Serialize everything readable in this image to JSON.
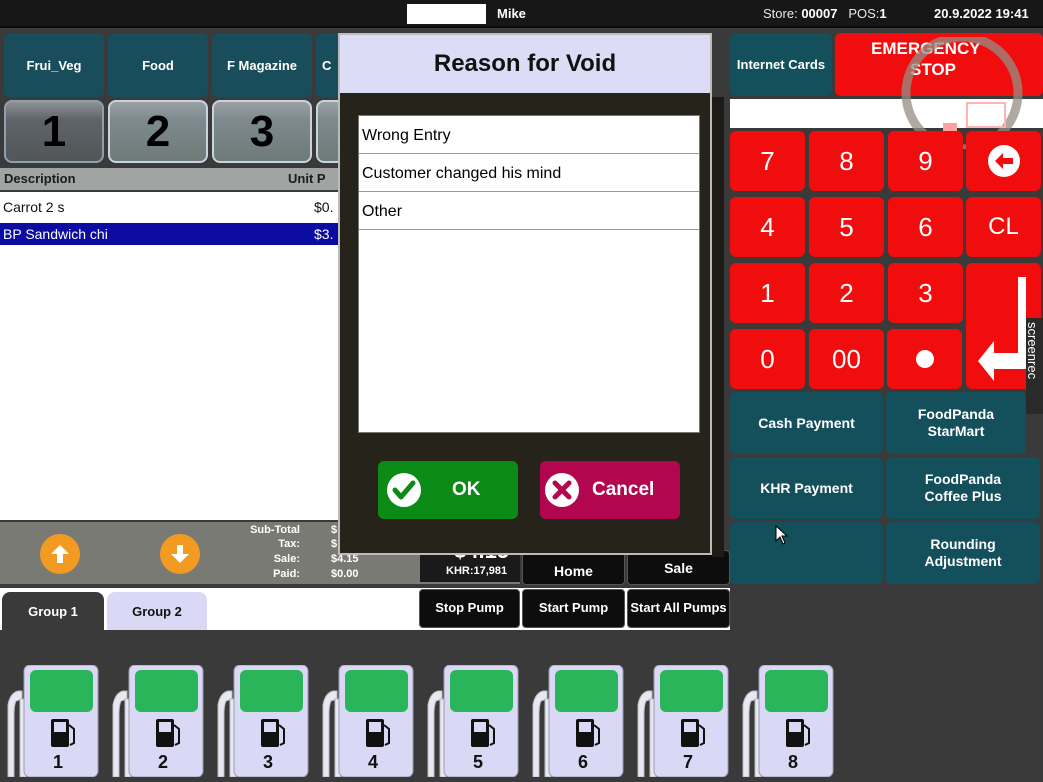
{
  "topbar": {
    "user": "Mike",
    "store_label": "Store:",
    "store": "00007",
    "pos_label": "POS:",
    "pos": "1",
    "datetime": "20.9.2022 19:41"
  },
  "categories": [
    "Frui_Veg",
    "Food",
    "F Magazine",
    "C"
  ],
  "tabs": [
    "1",
    "2",
    "3"
  ],
  "list": {
    "headers": {
      "description": "Description",
      "unit_price": "Unit P"
    },
    "rows": [
      {
        "description": "Carrot 2 s",
        "price": "$0."
      },
      {
        "description": "BP Sandwich chi",
        "price": "$3."
      }
    ]
  },
  "totals": {
    "subtotal_label": "Sub-Total",
    "tax_label": "Tax:",
    "sale_label": "Sale:",
    "paid_label": "Paid:",
    "subtotal_value": "$",
    "tax_value": "$",
    "sale_value": "$4.15",
    "paid_value": "$0.00",
    "big_total": "$4.15",
    "khr": "KHR:17,981"
  },
  "bottom_buttons": {
    "home": "Home",
    "sale": "Sale",
    "stop_pump": "Stop Pump",
    "start_pump": "Start Pump",
    "start_all": "Start All Pumps"
  },
  "pump_tabs": [
    "Group 1",
    "Group 2"
  ],
  "pumps": [
    "1",
    "2",
    "3",
    "4",
    "5",
    "6",
    "7",
    "8"
  ],
  "right": {
    "internet_cards": "Internet Cards",
    "emergency_line1": "EMERGENCY",
    "emergency_line2": "STOP",
    "keys": [
      "7",
      "8",
      "9",
      "4",
      "5",
      "6",
      "CL",
      "1",
      "2",
      "3",
      "0",
      "00"
    ],
    "cash_payment": "Cash Payment",
    "foodpanda_starmart": "FoodPanda StarMart",
    "khr_payment": "KHR Payment",
    "foodpanda_coffee": "FoodPanda Coffee Plus",
    "rounding": "Rounding Adjustment",
    "watermark": "screenrec"
  },
  "dialog": {
    "title": "Reason for Void",
    "reasons": [
      "Wrong Entry",
      "Customer changed his mind",
      "Other"
    ],
    "ok": "OK",
    "cancel": "Cancel"
  },
  "colors": {
    "teal": "#14505c",
    "red_key": "#f10d0d",
    "ok_green": "#0b8a16",
    "cancel_magenta": "#b2074f",
    "selection_blue": "#0c0ca3"
  }
}
